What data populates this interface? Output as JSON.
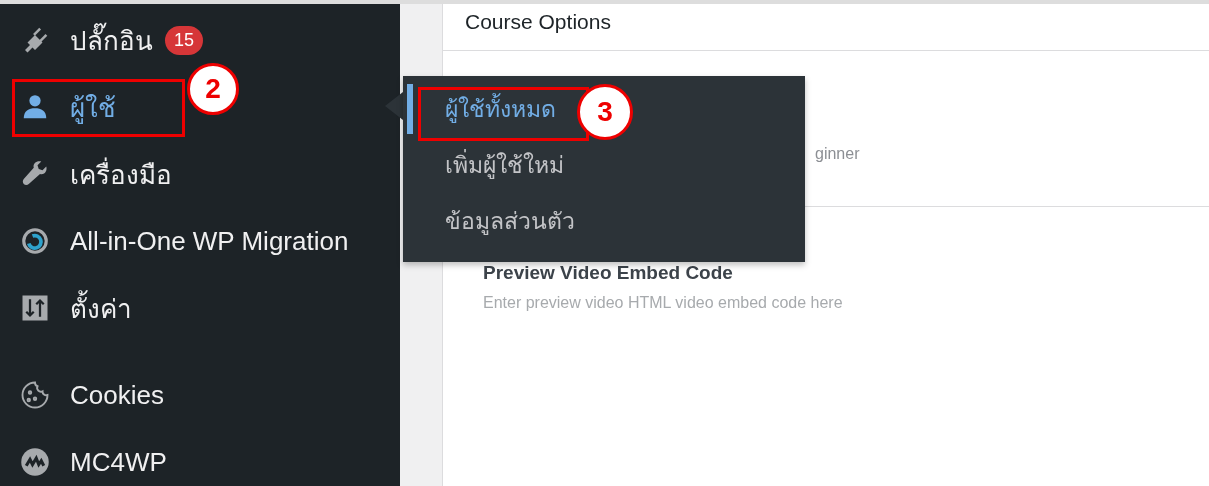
{
  "sidebar": {
    "groups": [
      {
        "items": [
          {
            "label": "ปลั๊กอิน",
            "kind": "plug",
            "badge": "15",
            "selected": false
          },
          {
            "label": "ผู้ใช้",
            "kind": "user",
            "selected": true,
            "callout": "2"
          },
          {
            "label": "เครื่องมือ",
            "kind": "wrench",
            "selected": false
          },
          {
            "label": "All-in-One WP Migration",
            "kind": "migration",
            "selected": false
          },
          {
            "label": "ตั้งค่า",
            "kind": "settings",
            "selected": false
          }
        ]
      },
      {
        "items": [
          {
            "label": "Cookies",
            "kind": "cookie",
            "selected": false
          },
          {
            "label": "MC4WP",
            "kind": "mc4wp",
            "selected": false
          }
        ]
      }
    ]
  },
  "flyout": {
    "items": [
      {
        "label": "ผู้ใช้ทั้งหมด",
        "selected": true,
        "callout": "3"
      },
      {
        "label": "เพิ่มผู้ใช้ใหม่",
        "selected": false
      },
      {
        "label": "ข้อมูลส่วนตัว",
        "selected": false
      }
    ]
  },
  "content": {
    "title": "Course Options",
    "partial_value": "ginner",
    "field": {
      "label": "Preview Video Embed Code",
      "hint": "Enter preview video HTML video embed code here"
    }
  }
}
